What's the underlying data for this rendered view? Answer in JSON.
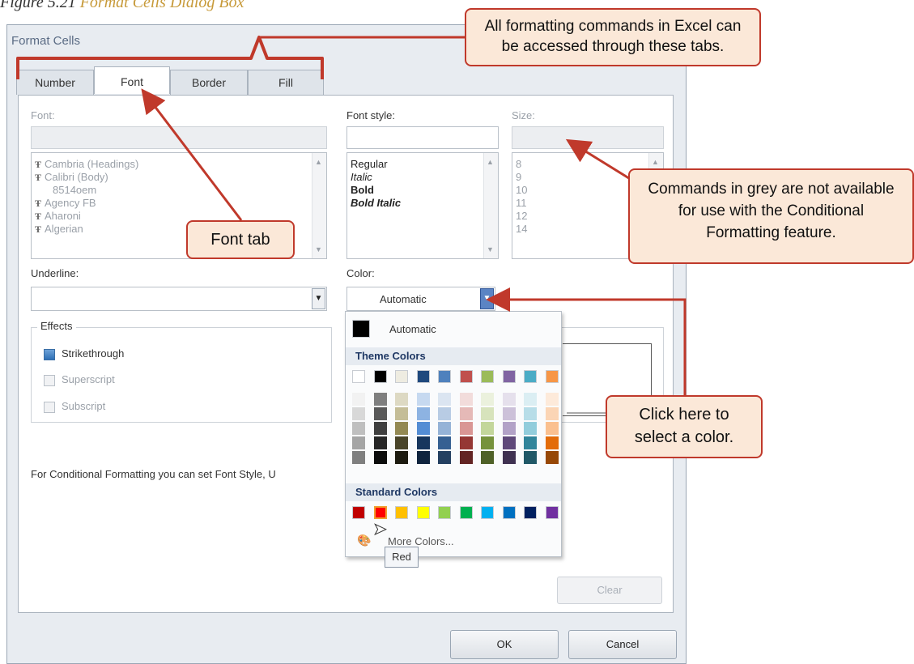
{
  "caption": {
    "prefix": "Figure 5.21",
    "title": "Format Cells Dialog Box"
  },
  "dialog": {
    "title": "Format Cells",
    "tabs": [
      "Number",
      "Font",
      "Border",
      "Fill"
    ],
    "font_label": "Font:",
    "font_style_label": "Font style:",
    "size_label": "Size:",
    "font_list": [
      "Cambria (Headings)",
      "Calibri (Body)",
      "8514oem",
      "Agency FB",
      "Aharoni",
      "Algerian"
    ],
    "style_list": [
      "Regular",
      "Italic",
      "Bold",
      "Bold Italic"
    ],
    "size_list": [
      "8",
      "9",
      "10",
      "11",
      "12",
      "14"
    ],
    "underline_label": "Underline:",
    "color_label": "Color:",
    "color_value": "Automatic",
    "effects_label": "Effects",
    "effects": [
      {
        "label": "Strikethrough",
        "checked": true,
        "enabled": true
      },
      {
        "label": "Superscript",
        "checked": false,
        "enabled": false
      },
      {
        "label": "Subscript",
        "checked": false,
        "enabled": false
      }
    ],
    "info_text": "For Conditional Formatting you can set Font Style, U",
    "clear_button": "Clear",
    "ok_button": "OK",
    "cancel_button": "Cancel"
  },
  "picker": {
    "automatic_label": "Automatic",
    "automatic_color": "#000000",
    "theme_label": "Theme Colors",
    "theme_top": [
      "#ffffff",
      "#000000",
      "#eeece1",
      "#1f497d",
      "#4f81bd",
      "#c0504d",
      "#9bbb59",
      "#8064a2",
      "#4bacc6",
      "#f79646"
    ],
    "theme_shades": [
      [
        "#f2f2f2",
        "#7f7f7f",
        "#ddd9c3",
        "#c6d9f0",
        "#dbe5f1",
        "#f2dcdb",
        "#ebf1dd",
        "#e5e0ec",
        "#dbeef3",
        "#fdeada"
      ],
      [
        "#d8d8d8",
        "#595959",
        "#c4bd97",
        "#8db3e2",
        "#b8cce4",
        "#e5b9b7",
        "#d7e3bc",
        "#ccc1d9",
        "#b7dde8",
        "#fbd5b5"
      ],
      [
        "#bfbfbf",
        "#3f3f3f",
        "#938953",
        "#548dd4",
        "#95b3d7",
        "#d99694",
        "#c3d69b",
        "#b2a2c7",
        "#92cddc",
        "#fac08f"
      ],
      [
        "#a5a5a5",
        "#262626",
        "#494429",
        "#17365d",
        "#366092",
        "#953734",
        "#76923c",
        "#5f497a",
        "#31859b",
        "#e36c09"
      ],
      [
        "#7f7f7f",
        "#0c0c0c",
        "#1d1b10",
        "#0f243e",
        "#244061",
        "#632423",
        "#4f6128",
        "#3f3151",
        "#205867",
        "#974806"
      ]
    ],
    "standard_label": "Standard Colors",
    "standard": [
      "#c00000",
      "#ff0000",
      "#ffc000",
      "#ffff00",
      "#92d050",
      "#00b050",
      "#00b0f0",
      "#0070c0",
      "#002060",
      "#7030a0"
    ],
    "more_colors": "More Colors...",
    "tooltip": "Red"
  },
  "callouts": {
    "tabs_note": "All formatting commands in Excel can be accessed through these tabs.",
    "font_tab_note": "Font tab",
    "grey_note": "Commands in grey are not available for use with the Conditional Formatting feature.",
    "color_note": "Click here to select a color."
  },
  "accent_color": "#c0392b"
}
